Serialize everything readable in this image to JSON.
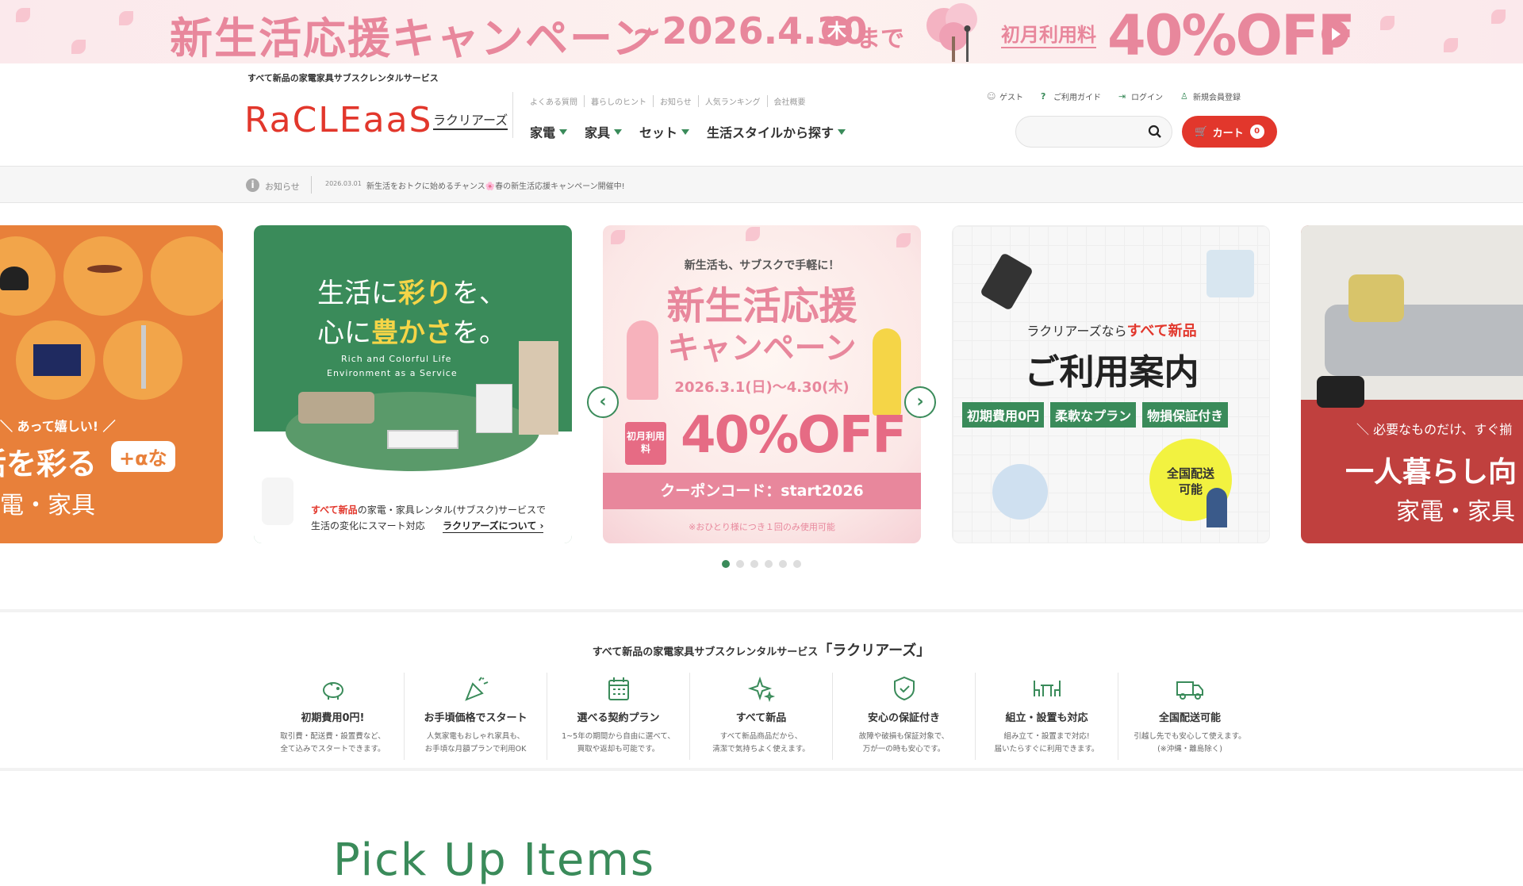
{
  "banner": {
    "title": "新生活応援キャンペーン",
    "date": "~2026.4.30",
    "weekday": "木",
    "until": "まで",
    "first_month_label": "初月利用料",
    "discount": "40%OFF"
  },
  "header": {
    "tagline": "すべて新品の家電家具サブスクレンタルサービス",
    "logo": "RaCLEaaS",
    "logo_kana": "ラクリアーズ",
    "subnav": [
      "よくある質問",
      "暮らしのヒント",
      "お知らせ",
      "人気ランキング",
      "会社概要"
    ],
    "mainnav": [
      "家電",
      "家具",
      "セット",
      "生活スタイルから探す"
    ],
    "usernav": [
      {
        "label": "ゲスト",
        "icon": "person-icon"
      },
      {
        "label": "ご利用ガイド",
        "icon": "question-icon"
      },
      {
        "label": "ログイン",
        "icon": "login-icon"
      },
      {
        "label": "新規会員登録",
        "icon": "person-add-icon"
      }
    ],
    "search_placeholder": "",
    "cart_label": "カート",
    "cart_count": "0"
  },
  "news": {
    "label": "お知らせ",
    "date": "2026.03.01",
    "text": "新生活をおトクに始めるチャンス🌸春の新生活応援キャンペーン開催中!"
  },
  "carousel": {
    "slide1": {
      "sub": "＼ あって嬉しい! ／",
      "line1": "活を彩る",
      "badge": "+αな",
      "line2": "家電・家具"
    },
    "slide2": {
      "line1a": "生活に",
      "line1b": "彩り",
      "line1c": "を、",
      "line2a": "心に",
      "line2b": "豊かさ",
      "line2c": "を。",
      "en1": "Rich and Colorful Life",
      "en2": "Environment as a Service",
      "desc1a": "すべて新品",
      "desc1b": "の家電・家具レンタル(サブスク)サービスで",
      "desc2": "生活の変化にスマート対応",
      "link": "ラクリアーズについて ›"
    },
    "slide3": {
      "top": "新生活も、サブスクで手軽に！",
      "title1": "新生活応援",
      "title2": "キャンペーン",
      "period": "2026.3.1(日)～4.30(木)",
      "first_label": "初月利用料",
      "discount": "40%OFF",
      "coupon": "クーポンコード：start2026",
      "note": "※おひとり様につき１回のみ使用可能"
    },
    "slide4": {
      "top_a": "ラクリアーズなら",
      "top_b": "すべて新品",
      "title": "ご利用案内",
      "tags": [
        "初期費用0円",
        "柔軟なプラン",
        "物損保証付き"
      ],
      "bubble": "全国配送可能"
    },
    "slide5": {
      "sub": "＼ 必要なものだけ、すぐ揃",
      "line1": "一人暮らし向",
      "line2": "家電・家具"
    },
    "dots": 6,
    "active_dot": 0
  },
  "features": {
    "title": "すべて新品の家電家具サブスクレンタルサービス",
    "brand": "「ラクリアーズ」",
    "items": [
      {
        "icon": "piggy-bank-icon",
        "title": "初期費用0円!",
        "desc": "取引費・配送費・設置費など、\n全て込みでスタートできます。"
      },
      {
        "icon": "party-popper-icon",
        "title": "お手頃価格でスタート",
        "desc": "人気家電もおしゃれ家具も、\nお手頃な月額プランで利用OK"
      },
      {
        "icon": "calendar-icon",
        "title": "選べる契約プラン",
        "desc": "1~5年の期間から自由に選べて、\n買取や返却も可能です。"
      },
      {
        "icon": "sparkle-icon",
        "title": "すべて新品",
        "desc": "すべて新品商品だから、\n清潔で気持ちよく使えます。"
      },
      {
        "icon": "shield-check-icon",
        "title": "安心の保証付き",
        "desc": "故障や破損も保証対象で、\n万が一の時も安心です。"
      },
      {
        "icon": "table-chairs-icon",
        "title": "組立・設置も対応",
        "desc": "組み立て・設置まで対応!\n届いたらすぐに利用できます。"
      },
      {
        "icon": "truck-icon",
        "title": "全国配送可能",
        "desc": "引越し先でも安心して使えます。\n(※沖縄・離島除く)"
      }
    ]
  },
  "pickup_title": "Pick Up Items"
}
